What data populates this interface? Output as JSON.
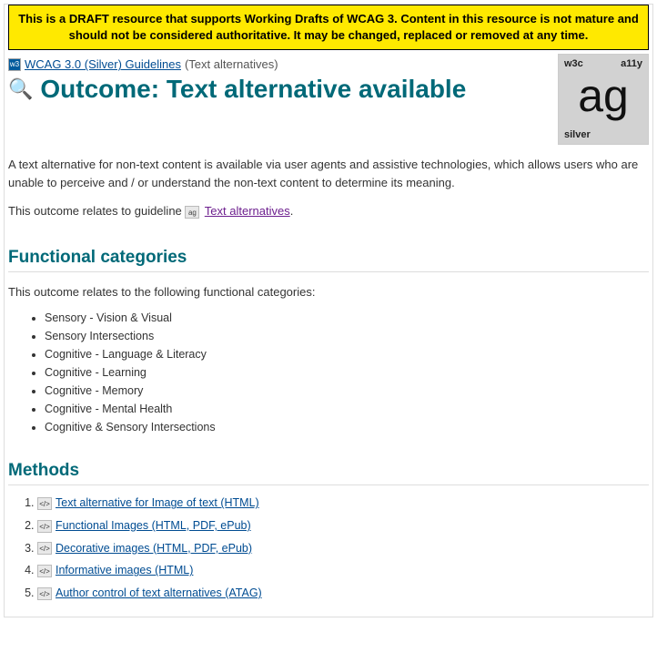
{
  "banner": "This is a DRAFT resource that supports Working Drafts of WCAG 3. Content in this resource is not mature and should not be considered authoritative. It may be changed, replaced or removed at any time.",
  "breadcrumb": {
    "link": "WCAG 3.0 (Silver) Guidelines",
    "current": "(Text alternatives)"
  },
  "page_title": "Outcome: Text alternative available",
  "logo": {
    "top_left": "w3c",
    "top_right": "a11y",
    "center": "ag",
    "bottom_left": "silver"
  },
  "intro": "A text alternative for non-text content is available via user agents and assistive technologies, which allows users who are unable to perceive and / or understand the non-text content to determine its meaning.",
  "guideline_sentence_prefix": "This outcome relates to guideline ",
  "guideline_link": "Text alternatives",
  "guideline_sentence_suffix": ".",
  "functional": {
    "heading": "Functional categories",
    "intro": "This outcome relates to the following functional categories:",
    "items": [
      "Sensory - Vision & Visual",
      "Sensory Intersections",
      "Cognitive - Language & Literacy",
      "Cognitive - Learning",
      "Cognitive - Memory",
      "Cognitive - Mental Health",
      "Cognitive & Sensory Intersections"
    ]
  },
  "methods": {
    "heading": "Methods",
    "items": [
      "Text alternative for Image of text (HTML)",
      "Functional Images (HTML, PDF, ePub)",
      "Decorative images (HTML, PDF, ePub)",
      "Informative images (HTML)",
      "Author control of text alternatives (ATAG)"
    ]
  }
}
